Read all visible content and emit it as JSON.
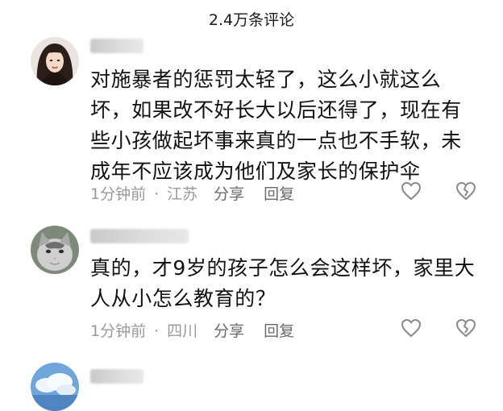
{
  "header": {
    "comment_count_title": "2.4万条评论"
  },
  "comments": [
    {
      "avatar": "girl-avatar",
      "username": "",
      "text_lines": [
        "对施暴者的惩罚太轻了，这么小就这么",
        "坏，如果改不好长大以后还得了，现在有",
        "些小孩做起坏事来真的一点也不手软，未",
        "成年不应该成为他们及家长的保护伞"
      ],
      "time": "1分钟前",
      "separator": "·",
      "location": "江苏",
      "share_label": "分享",
      "reply_label": "回复",
      "like_icon": "heart-outline-icon",
      "dislike_icon": "broken-heart-icon"
    },
    {
      "avatar": "cat-avatar",
      "username": "",
      "text_lines": [
        "真的，才9岁的孩子怎么会这样坏，家里大",
        "人从小怎么教育的？"
      ],
      "time": "1分钟前",
      "separator": "·",
      "location": "四川",
      "share_label": "分享",
      "reply_label": "回复",
      "like_icon": "heart-outline-icon",
      "dislike_icon": "broken-heart-icon"
    },
    {
      "avatar": "sky-avatar",
      "username": ""
    }
  ],
  "colors": {
    "text": "#111111",
    "meta": "#9a9a9a",
    "action": "#6a6a6a",
    "icon": "#8a8a8a",
    "background": "#ffffff"
  }
}
